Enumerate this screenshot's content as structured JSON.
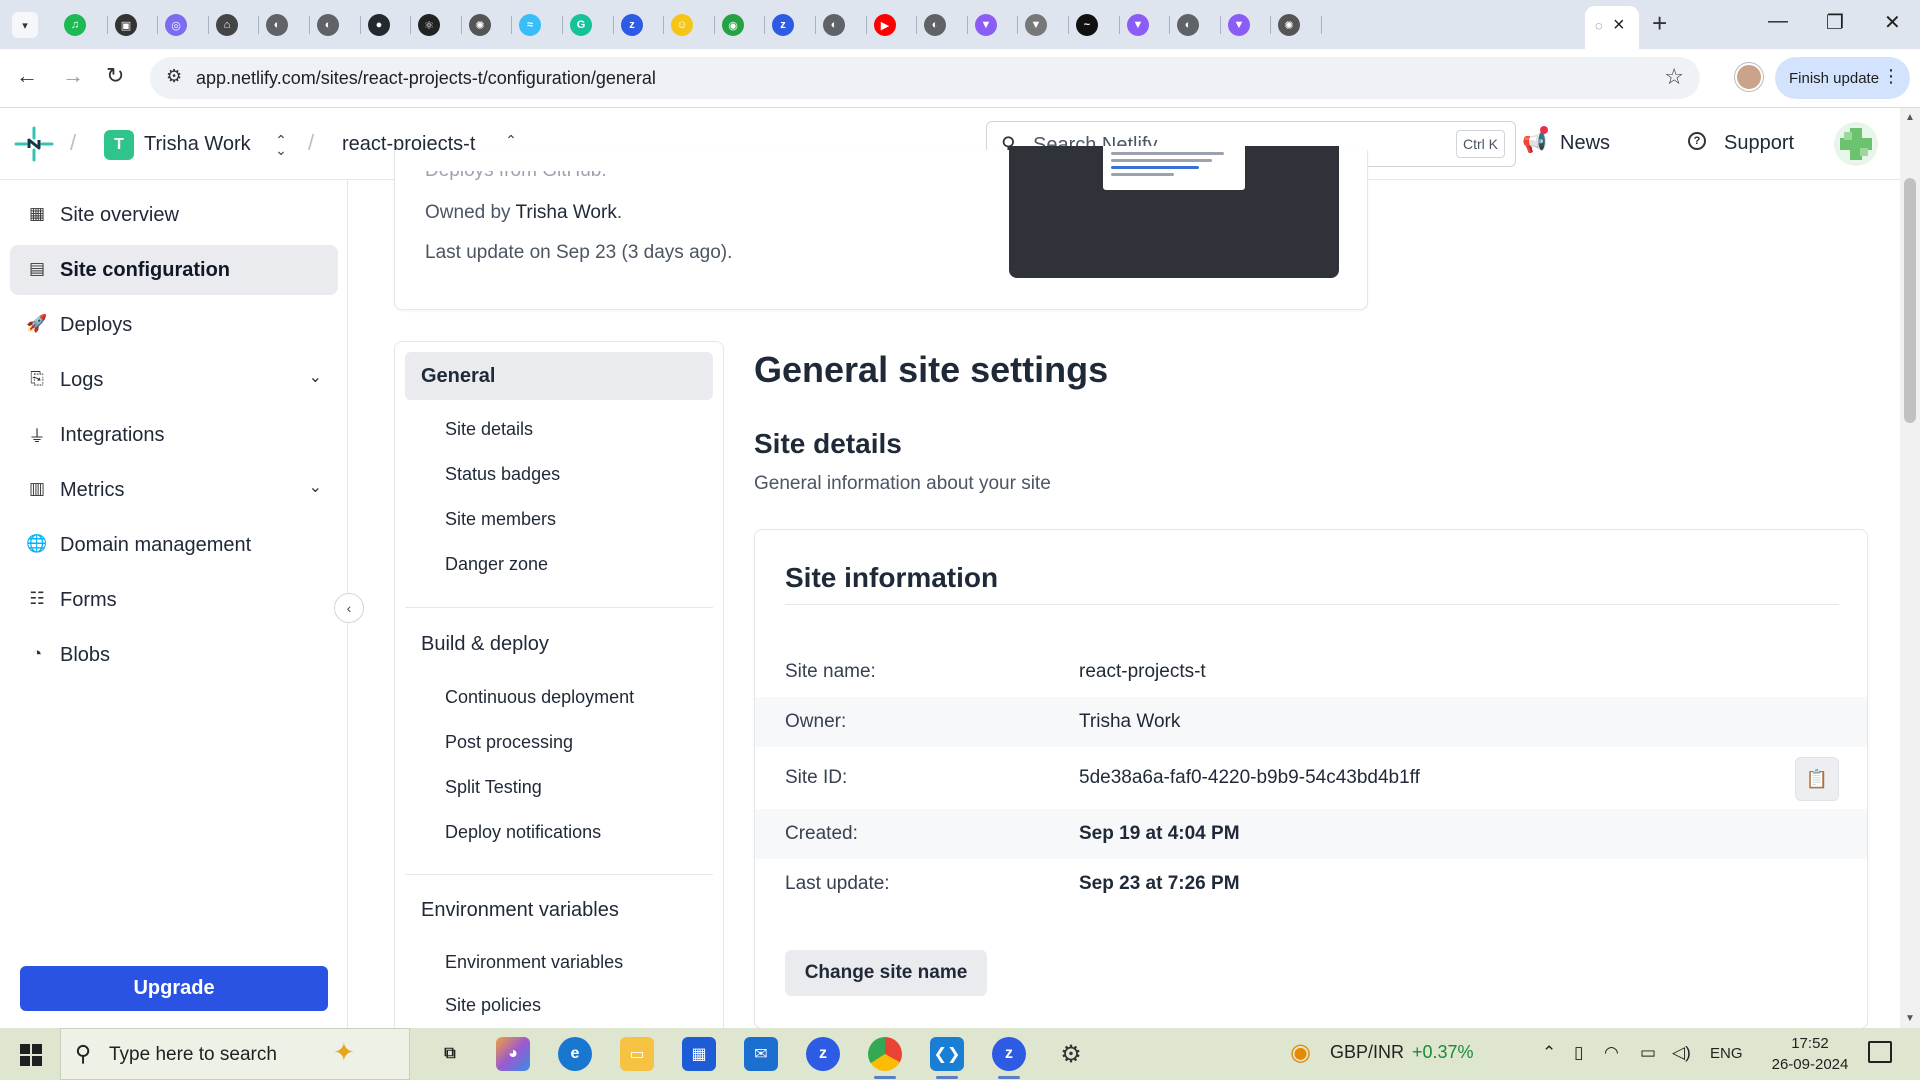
{
  "browser": {
    "url": "app.netlify.com/sites/react-projects-t/configuration/general",
    "finish_update": "Finish update",
    "tab_favicons": [
      {
        "name": "spotify-tab",
        "color": "#1db954",
        "glyph": "♫"
      },
      {
        "name": "media-tab",
        "color": "#333333",
        "glyph": "▣"
      },
      {
        "name": "ai-tab",
        "color": "#7c6cf0",
        "glyph": "◎"
      },
      {
        "name": "bot-tab",
        "color": "#444444",
        "glyph": "⌂"
      },
      {
        "name": "web-tab-1",
        "color": "#5f6368",
        "glyph": "◐"
      },
      {
        "name": "web-tab-2",
        "color": "#5f6368",
        "glyph": "◐"
      },
      {
        "name": "github-tab",
        "color": "#24292f",
        "glyph": "●"
      },
      {
        "name": "react-tab",
        "color": "#222222",
        "glyph": "⚛"
      },
      {
        "name": "openai-tab",
        "color": "#555555",
        "glyph": "✺"
      },
      {
        "name": "tailwind-tab",
        "color": "#38bdf8",
        "glyph": "≈"
      },
      {
        "name": "grammarly-tab",
        "color": "#15c39a",
        "glyph": "G"
      },
      {
        "name": "zm-tab-1",
        "color": "#2d5be3",
        "glyph": "z"
      },
      {
        "name": "emoji-tab",
        "color": "#f5c518",
        "glyph": "☺"
      },
      {
        "name": "chat-tab",
        "color": "#25a244",
        "glyph": "◉"
      },
      {
        "name": "zm-tab-2",
        "color": "#2d5be3",
        "glyph": "z"
      },
      {
        "name": "web-tab-3",
        "color": "#5f6368",
        "glyph": "◐"
      },
      {
        "name": "youtube-tab",
        "color": "#ff0000",
        "glyph": "▶"
      },
      {
        "name": "web-tab-4",
        "color": "#5f6368",
        "glyph": "◐"
      },
      {
        "name": "vite-tab-1",
        "color": "#8b5cf6",
        "glyph": "▼"
      },
      {
        "name": "vercel-tab",
        "color": "#777777",
        "glyph": "▼"
      },
      {
        "name": "tailwind-tab-2",
        "color": "#111111",
        "glyph": "~"
      },
      {
        "name": "vite-tab-2",
        "color": "#8b5cf6",
        "glyph": "▼"
      },
      {
        "name": "web-tab-5",
        "color": "#5f6368",
        "glyph": "◐"
      },
      {
        "name": "vite-tab-3",
        "color": "#8b5cf6",
        "glyph": "▼"
      },
      {
        "name": "openai-tab-2",
        "color": "#555555",
        "glyph": "✺"
      }
    ]
  },
  "header": {
    "team_initial": "T",
    "team_name": "Trisha Work",
    "site_name": "react-projects-t",
    "search_placeholder": "Search Netlify...",
    "search_shortcut": "Ctrl K",
    "news_label": "News",
    "support_label": "Support"
  },
  "sidebar": {
    "items": [
      {
        "label": "Site overview",
        "icon": "grid-icon"
      },
      {
        "label": "Site configuration",
        "icon": "settings-panel-icon"
      },
      {
        "label": "Deploys",
        "icon": "rocket-icon"
      },
      {
        "label": "Logs",
        "icon": "logs-icon"
      },
      {
        "label": "Integrations",
        "icon": "plug-icon"
      },
      {
        "label": "Metrics",
        "icon": "bar-chart-icon"
      },
      {
        "label": "Domain management",
        "icon": "globe-icon"
      },
      {
        "label": "Forms",
        "icon": "form-icon"
      },
      {
        "label": "Blobs",
        "icon": "blob-icon"
      }
    ],
    "upgrade_label": "Upgrade"
  },
  "site_card": {
    "deploys_from": "Deploys from GitHub.",
    "owned_by_prefix": "Owned by",
    "owner": "Trisha Work",
    "last_update": "Last update on Sep 23 (3 days ago)."
  },
  "subnav": {
    "general": "General",
    "general_links": [
      "Site details",
      "Status badges",
      "Site members",
      "Danger zone"
    ],
    "build_deploy": "Build & deploy",
    "build_links": [
      "Continuous deployment",
      "Post processing",
      "Split Testing",
      "Deploy notifications"
    ],
    "env_vars": "Environment variables",
    "env_links": [
      "Environment variables",
      "Site policies"
    ]
  },
  "main": {
    "page_title": "General site settings",
    "section_title": "Site details",
    "section_desc": "General information about your site",
    "card_title": "Site information",
    "rows": [
      {
        "label": "Site name:",
        "value": "react-projects-t"
      },
      {
        "label": "Owner:",
        "value": "Trisha Work"
      },
      {
        "label": "Site ID:",
        "value": "5de38a6a-faf0-4220-b9b9-54c43bd4b1ff"
      },
      {
        "label": "Created:",
        "value": "Sep 19 at 4:04 PM"
      },
      {
        "label": "Last update:",
        "value": "Sep 23 at 7:26 PM"
      }
    ],
    "change_button": "Change site name"
  },
  "taskbar": {
    "search_text": "Type here to search",
    "ticker_symbol": "GBP/INR",
    "ticker_change": "+0.37%",
    "language": "ENG",
    "time": "17:52",
    "date": "26-09-2024"
  }
}
